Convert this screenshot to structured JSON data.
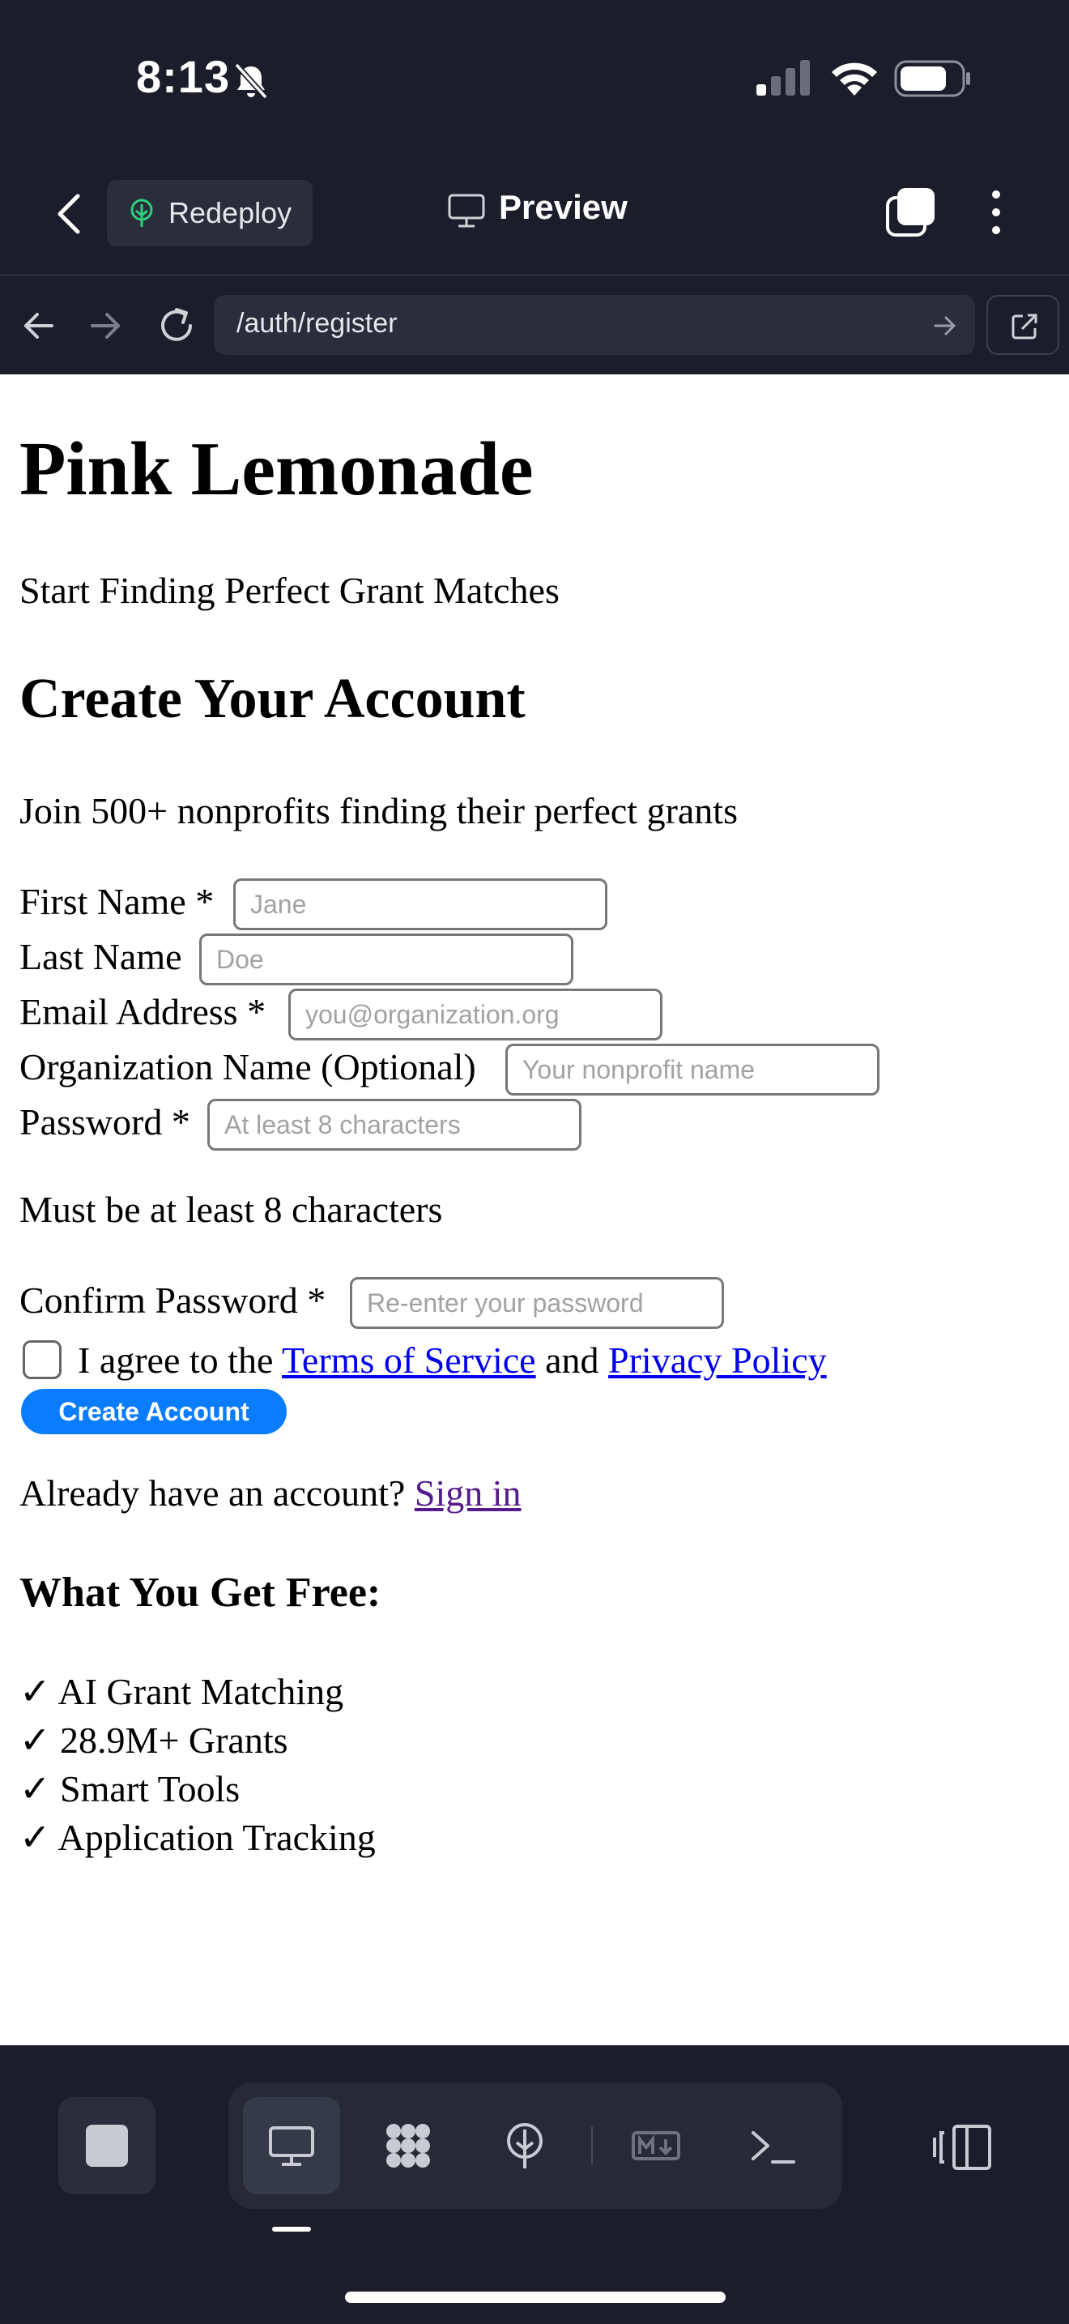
{
  "status_bar": {
    "time": "8:13"
  },
  "header": {
    "redeploy_label": "Redeploy",
    "title": "Preview"
  },
  "browser": {
    "url": "/auth/register"
  },
  "page": {
    "brand": "Pink Lemonade",
    "tagline": "Start Finding Perfect Grant Matches",
    "heading": "Create Your Account",
    "intro": "Join 500+ nonprofits finding their perfect grants",
    "fields": {
      "first_name": {
        "label": "First Name *",
        "placeholder": "Jane",
        "value": ""
      },
      "last_name": {
        "label": "Last Name",
        "placeholder": "Doe",
        "value": ""
      },
      "email": {
        "label": "Email Address *",
        "placeholder": "you@organization.org",
        "value": ""
      },
      "organization": {
        "label": "Organization Name (Optional)",
        "placeholder": "Your nonprofit name",
        "value": ""
      },
      "password": {
        "label": "Password *",
        "placeholder": "At least 8 characters",
        "value": ""
      },
      "password_hint": "Must be at least 8 characters",
      "confirm_password": {
        "label": "Confirm Password *",
        "placeholder": "Re-enter your password",
        "value": ""
      }
    },
    "agree": {
      "prefix": "I agree to the",
      "terms": "Terms of Service",
      "conjunction": "and",
      "privacy": "Privacy Policy",
      "checked": false
    },
    "submit_label": "Create Account",
    "signin_prompt": "Already have an account?",
    "signin_link": "Sign in",
    "benefits_heading": "What You Get Free:",
    "benefits": [
      "✓ AI Grant Matching",
      "✓ 28.9M+ Grants",
      "✓ Smart Tools",
      "✓ Application Tracking"
    ]
  },
  "toolbar": {
    "active_tool": "preview",
    "tools": [
      "monitor-icon",
      "grid-icon",
      "deploy-icon",
      "markdown-icon",
      "terminal-icon"
    ]
  },
  "colors": {
    "chrome_bg": "#1b1e2a",
    "button_blue": "#0a7cff",
    "link_blue": "#0000ee",
    "visited_link": "#551a8b"
  }
}
